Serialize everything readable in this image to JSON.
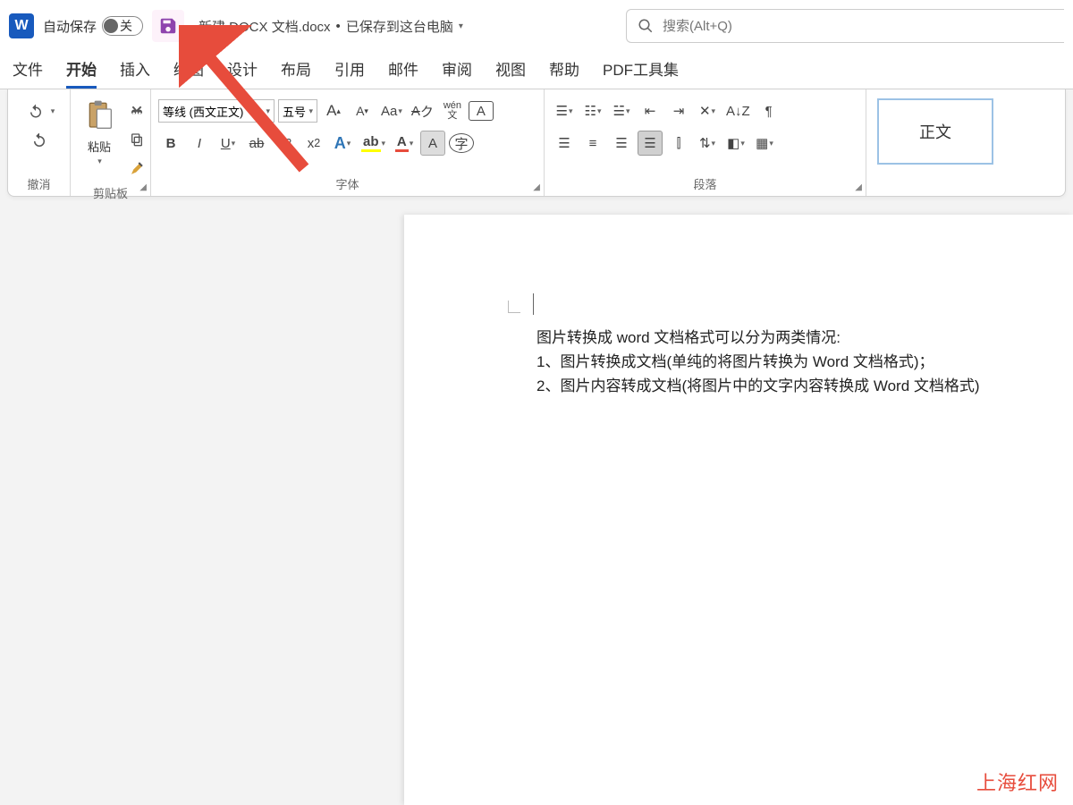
{
  "titlebar": {
    "autosave_label": "自动保存",
    "toggle_state": "关",
    "doc_name": "新建 DOCX 文档.docx",
    "save_status": "已保存到这台电脑",
    "search_placeholder": "搜索(Alt+Q)"
  },
  "tabs": [
    "文件",
    "开始",
    "插入",
    "绘图",
    "设计",
    "布局",
    "引用",
    "邮件",
    "审阅",
    "视图",
    "帮助",
    "PDF工具集"
  ],
  "active_tab": "开始",
  "ribbon": {
    "undo_group": "撤消",
    "clipboard_group": "剪贴板",
    "paste_label": "粘贴",
    "font_group": "字体",
    "font_name": "等线 (西文正文)",
    "font_size": "五号",
    "paragraph_group": "段落",
    "style_body": "正文"
  },
  "document": {
    "line1": "图片转换成 word 文档格式可以分为两类情况:",
    "line2": "1、图片转换成文档(单纯的将图片转换为 Word 文档格式)；",
    "line3": "2、图片内容转成文档(将图片中的文字内容转换成 Word 文档格式)"
  },
  "watermark": "上海红网"
}
